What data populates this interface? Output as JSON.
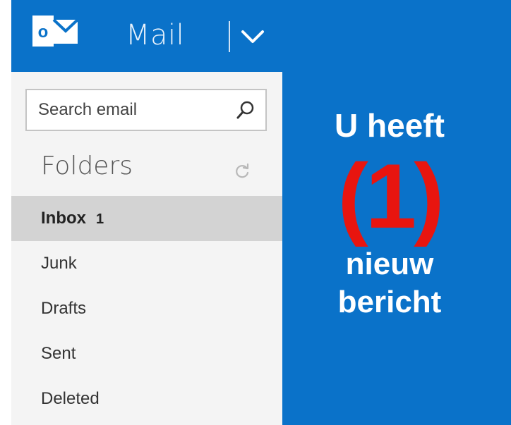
{
  "header": {
    "logo_letter": "o",
    "app_title": "Mail"
  },
  "sidebar": {
    "search": {
      "placeholder": "Search email"
    },
    "folders_heading": "Folders",
    "folders": [
      {
        "label": "Inbox",
        "count": "1",
        "active": true
      },
      {
        "label": "Junk"
      },
      {
        "label": "Drafts"
      },
      {
        "label": "Sent"
      },
      {
        "label": "Deleted"
      }
    ]
  },
  "message": {
    "line1": "U heeft",
    "count": "(1)",
    "line2": "nieuw",
    "line3": "bericht"
  },
  "icons": {
    "logo": "outlook-logo-icon",
    "menu": "chevron-down-icon",
    "search": "search-icon",
    "refresh": "refresh-icon"
  },
  "colors": {
    "brand_blue": "#0a72c9",
    "sidebar_bg": "#f4f4f4",
    "active_item": "#d3d3d3",
    "count_red": "#e8150f"
  }
}
